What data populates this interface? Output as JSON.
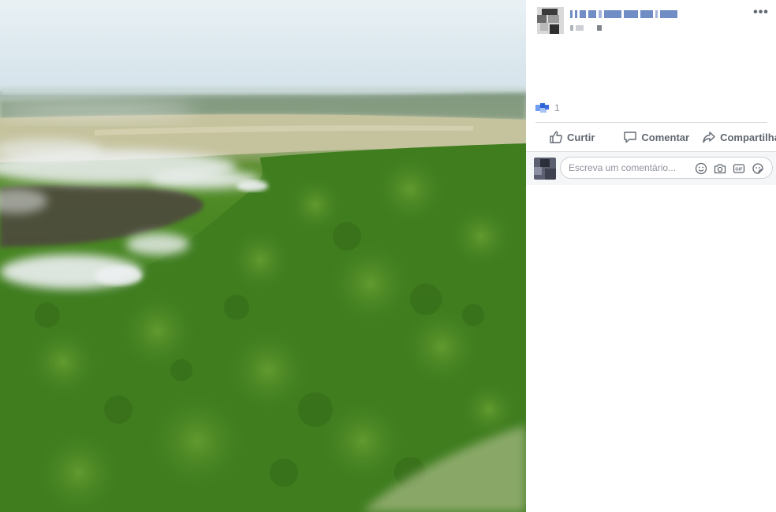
{
  "post": {
    "more_label": "•••",
    "reaction_count": "1",
    "photo_alt": "Aerial view of forest with smoke from fires"
  },
  "actions": {
    "like_label": "Curtir",
    "comment_label": "Comentar",
    "share_label": "Compartilhar"
  },
  "comment_box": {
    "placeholder": "Escreva um comentário..."
  },
  "icons": {
    "like": "thumbs-up-icon",
    "comment": "speech-bubble-icon",
    "share": "share-arrow-icon",
    "emoji": "smiley-icon",
    "camera": "camera-icon",
    "gif": "gif-icon",
    "sticker": "sticker-icon",
    "more": "more-dots-icon"
  },
  "colors": {
    "text_secondary": "#606770",
    "link_blue": "#4267b2",
    "separator": "#dadde1",
    "comment_bg": "#f5f6f7"
  }
}
